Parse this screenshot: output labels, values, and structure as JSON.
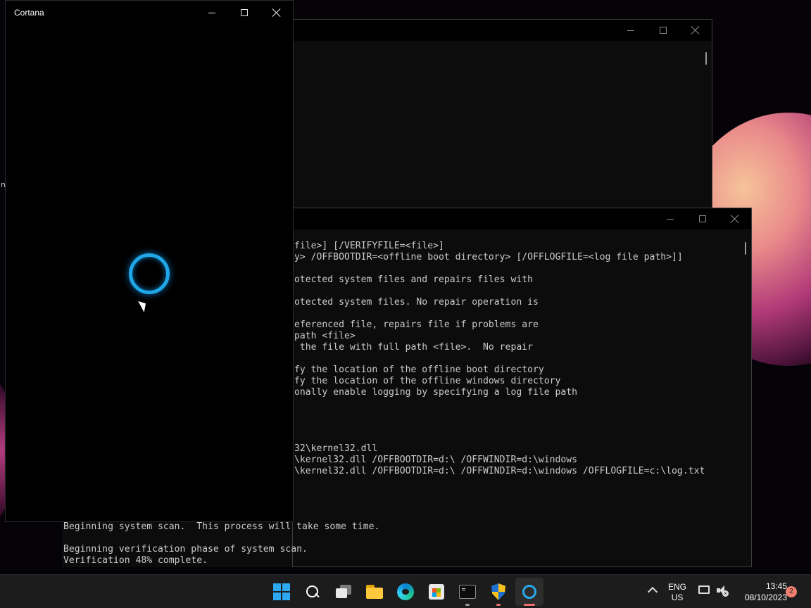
{
  "desktop": {
    "edge_glyph": "n"
  },
  "back_console": {
    "lines": [
      "file>] [/VERIFYFILE=<file>]",
      "y> /OFFBOOTDIR=<offline boot directory> [/OFFLOGFILE=<log file path>]]",
      "",
      "otected system files and repairs files with",
      "",
      "otected system files. No repair operation is",
      "",
      "eferenced file, repairs file if problems are",
      "path <file>",
      " the file with full path <file>.  No repair",
      "",
      "fy the location of the offline boot directory",
      "fy the location of the offline windows directory",
      "onally enable logging by specifying a log file path",
      "",
      "",
      "",
      "",
      "32\\kernel32.dll",
      "\\kernel32.dll /OFFBOOTDIR=d:\\ /OFFWINDIR=d:\\windows",
      "\\kernel32.dll /OFFBOOTDIR=d:\\ /OFFWINDIR=d:\\windows /OFFLOGFILE=c:\\log.txt"
    ],
    "scan_lines": [
      "Beginning system scan.  This process will take some time.",
      "",
      "Beginning verification phase of system scan.",
      "Verification 48% complete."
    ]
  },
  "cortana": {
    "title": "Cortana",
    "ring_color": "#1fa7e8"
  },
  "taskbar": {
    "items": [
      {
        "name": "start",
        "icon": "windows-logo-icon"
      },
      {
        "name": "search",
        "icon": "search-icon"
      },
      {
        "name": "task-view",
        "icon": "task-view-icon"
      },
      {
        "name": "file-explorer",
        "icon": "folder-icon"
      },
      {
        "name": "edge",
        "icon": "edge-icon"
      },
      {
        "name": "store",
        "icon": "store-icon"
      },
      {
        "name": "terminal",
        "icon": "terminal-icon"
      },
      {
        "name": "security",
        "icon": "shield-icon"
      },
      {
        "name": "cortana",
        "icon": "cortana-icon"
      }
    ],
    "accent": "#f07070"
  },
  "tray": {
    "lang_line1": "ENG",
    "lang_line2": "US",
    "time": "13:45",
    "date": "08/10/2023",
    "notification_count": "2"
  }
}
